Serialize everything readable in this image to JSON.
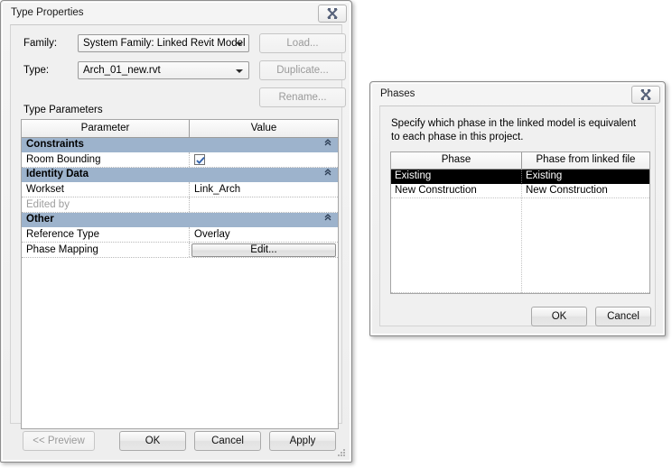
{
  "type_properties": {
    "title": "Type Properties",
    "close_icon": "close-icon",
    "family_label": "Family:",
    "family_value": "System Family: Linked Revit Model",
    "type_label": "Type:",
    "type_value": "Arch_01_new.rvt",
    "load_label": "Load...",
    "duplicate_label": "Duplicate...",
    "rename_label": "Rename...",
    "type_parameters_label": "Type Parameters",
    "columns": [
      "Parameter",
      "Value"
    ],
    "groups": [
      {
        "name": "Constraints",
        "collapse_icon": "collapse-icon",
        "rows": [
          {
            "name": "Room Bounding",
            "value": "",
            "kind": "checkbox",
            "checked": true,
            "dim": false
          }
        ]
      },
      {
        "name": "Identity Data",
        "collapse_icon": "collapse-icon",
        "rows": [
          {
            "name": "Workset",
            "value": "Link_Arch",
            "kind": "text",
            "dim": false
          },
          {
            "name": "Edited by",
            "value": "",
            "kind": "text",
            "dim": true
          }
        ]
      },
      {
        "name": "Other",
        "collapse_icon": "collapse-icon",
        "rows": [
          {
            "name": "Reference Type",
            "value": "Overlay",
            "kind": "text",
            "dim": false
          },
          {
            "name": "Phase Mapping",
            "value": "Edit...",
            "kind": "button",
            "dim": false
          }
        ]
      }
    ],
    "preview_label": "<< Preview",
    "ok_label": "OK",
    "cancel_label": "Cancel",
    "apply_label": "Apply"
  },
  "phases": {
    "title": "Phases",
    "close_icon": "close-icon",
    "description": "Specify which phase in the linked model is equivalent to each phase in this project.",
    "columns": [
      "Phase",
      "Phase from linked file"
    ],
    "rows": [
      {
        "phase": "Existing",
        "linked": "Existing",
        "selected": true
      },
      {
        "phase": "New Construction",
        "linked": "New Construction",
        "selected": false
      }
    ],
    "ok_label": "OK",
    "cancel_label": "Cancel"
  },
  "colors": {
    "section_header": "#9db3cc",
    "selection": "#000000",
    "dialog_face": "#f0f0f0"
  }
}
